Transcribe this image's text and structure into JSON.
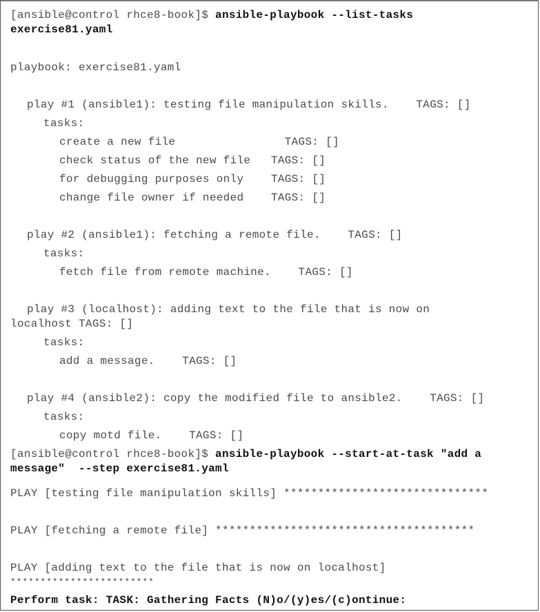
{
  "prompt": "[ansible@control rhce8-book]$ ",
  "cmd1": {
    "part1": "ansible-playbook --list-tasks",
    "part2": "exercise81.yaml"
  },
  "playbook_line": "playbook: exercise81.yaml",
  "plays": [
    {
      "header": "play #1 (ansible1): testing file manipulation skills.    TAGS: []",
      "tasks_label": "tasks:",
      "tasks": [
        "create a new file                TAGS: []",
        "check status of the new file   TAGS: []",
        "for debugging purposes only    TAGS: []",
        "change file owner if needed    TAGS: []"
      ]
    },
    {
      "header": "play #2 (ansible1): fetching a remote file.    TAGS: []",
      "tasks_label": "tasks:",
      "tasks": [
        "fetch file from remote machine.    TAGS: []"
      ]
    },
    {
      "header": "play #3 (localhost): adding text to the file that is now on",
      "header_cont": "localhost TAGS: []",
      "tasks_label": "tasks:",
      "tasks": [
        "add a message.    TAGS: []"
      ]
    },
    {
      "header": "play #4 (ansible2): copy the modified file to ansible2.    TAGS: []",
      "tasks_label": "tasks:",
      "tasks": [
        "copy motd file.    TAGS: []"
      ]
    }
  ],
  "cmd2": {
    "part1": "ansible-playbook --start-at-task \"add a",
    "part2": "message\"  --step exercise81.yaml"
  },
  "output": {
    "play1": "PLAY [testing file manipulation skills] ******************************",
    "play2": "PLAY [fetching a remote file] **************************************",
    "play3": "PLAY [adding text to the file that is now on localhost]",
    "play3_stars": "************************",
    "prompt_line": "Perform task: TASK: Gathering Facts (N)o/(y)es/(c)ontinue:"
  }
}
